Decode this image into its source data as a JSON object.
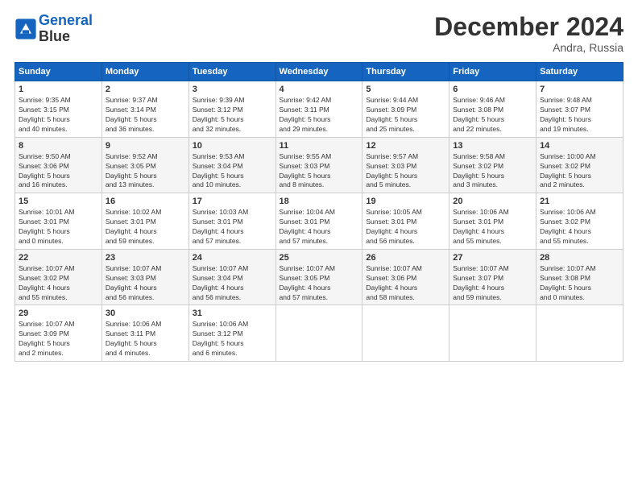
{
  "logo": {
    "line1": "General",
    "line2": "Blue"
  },
  "title": "December 2024",
  "location": "Andra, Russia",
  "header_days": [
    "Sunday",
    "Monday",
    "Tuesday",
    "Wednesday",
    "Thursday",
    "Friday",
    "Saturday"
  ],
  "weeks": [
    [
      {
        "day": "1",
        "sunrise": "9:35 AM",
        "sunset": "3:15 PM",
        "daylight": "5 hours and 40 minutes."
      },
      {
        "day": "2",
        "sunrise": "9:37 AM",
        "sunset": "3:14 PM",
        "daylight": "5 hours and 36 minutes."
      },
      {
        "day": "3",
        "sunrise": "9:39 AM",
        "sunset": "3:12 PM",
        "daylight": "5 hours and 32 minutes."
      },
      {
        "day": "4",
        "sunrise": "9:42 AM",
        "sunset": "3:11 PM",
        "daylight": "5 hours and 29 minutes."
      },
      {
        "day": "5",
        "sunrise": "9:44 AM",
        "sunset": "3:09 PM",
        "daylight": "5 hours and 25 minutes."
      },
      {
        "day": "6",
        "sunrise": "9:46 AM",
        "sunset": "3:08 PM",
        "daylight": "5 hours and 22 minutes."
      },
      {
        "day": "7",
        "sunrise": "9:48 AM",
        "sunset": "3:07 PM",
        "daylight": "5 hours and 19 minutes."
      }
    ],
    [
      {
        "day": "8",
        "sunrise": "9:50 AM",
        "sunset": "3:06 PM",
        "daylight": "5 hours and 16 minutes."
      },
      {
        "day": "9",
        "sunrise": "9:52 AM",
        "sunset": "3:05 PM",
        "daylight": "5 hours and 13 minutes."
      },
      {
        "day": "10",
        "sunrise": "9:53 AM",
        "sunset": "3:04 PM",
        "daylight": "5 hours and 10 minutes."
      },
      {
        "day": "11",
        "sunrise": "9:55 AM",
        "sunset": "3:03 PM",
        "daylight": "5 hours and 8 minutes."
      },
      {
        "day": "12",
        "sunrise": "9:57 AM",
        "sunset": "3:03 PM",
        "daylight": "5 hours and 5 minutes."
      },
      {
        "day": "13",
        "sunrise": "9:58 AM",
        "sunset": "3:02 PM",
        "daylight": "5 hours and 3 minutes."
      },
      {
        "day": "14",
        "sunrise": "10:00 AM",
        "sunset": "3:02 PM",
        "daylight": "5 hours and 2 minutes."
      }
    ],
    [
      {
        "day": "15",
        "sunrise": "10:01 AM",
        "sunset": "3:01 PM",
        "daylight": "5 hours and 0 minutes."
      },
      {
        "day": "16",
        "sunrise": "10:02 AM",
        "sunset": "3:01 PM",
        "daylight": "4 hours and 59 minutes."
      },
      {
        "day": "17",
        "sunrise": "10:03 AM",
        "sunset": "3:01 PM",
        "daylight": "4 hours and 57 minutes."
      },
      {
        "day": "18",
        "sunrise": "10:04 AM",
        "sunset": "3:01 PM",
        "daylight": "4 hours and 57 minutes."
      },
      {
        "day": "19",
        "sunrise": "10:05 AM",
        "sunset": "3:01 PM",
        "daylight": "4 hours and 56 minutes."
      },
      {
        "day": "20",
        "sunrise": "10:06 AM",
        "sunset": "3:01 PM",
        "daylight": "4 hours and 55 minutes."
      },
      {
        "day": "21",
        "sunrise": "10:06 AM",
        "sunset": "3:02 PM",
        "daylight": "4 hours and 55 minutes."
      }
    ],
    [
      {
        "day": "22",
        "sunrise": "10:07 AM",
        "sunset": "3:02 PM",
        "daylight": "4 hours and 55 minutes."
      },
      {
        "day": "23",
        "sunrise": "10:07 AM",
        "sunset": "3:03 PM",
        "daylight": "4 hours and 56 minutes."
      },
      {
        "day": "24",
        "sunrise": "10:07 AM",
        "sunset": "3:04 PM",
        "daylight": "4 hours and 56 minutes."
      },
      {
        "day": "25",
        "sunrise": "10:07 AM",
        "sunset": "3:05 PM",
        "daylight": "4 hours and 57 minutes."
      },
      {
        "day": "26",
        "sunrise": "10:07 AM",
        "sunset": "3:06 PM",
        "daylight": "4 hours and 58 minutes."
      },
      {
        "day": "27",
        "sunrise": "10:07 AM",
        "sunset": "3:07 PM",
        "daylight": "4 hours and 59 minutes."
      },
      {
        "day": "28",
        "sunrise": "10:07 AM",
        "sunset": "3:08 PM",
        "daylight": "5 hours and 0 minutes."
      }
    ],
    [
      {
        "day": "29",
        "sunrise": "10:07 AM",
        "sunset": "3:09 PM",
        "daylight": "5 hours and 2 minutes."
      },
      {
        "day": "30",
        "sunrise": "10:06 AM",
        "sunset": "3:11 PM",
        "daylight": "5 hours and 4 minutes."
      },
      {
        "day": "31",
        "sunrise": "10:06 AM",
        "sunset": "3:12 PM",
        "daylight": "5 hours and 6 minutes."
      },
      null,
      null,
      null,
      null
    ]
  ],
  "labels": {
    "sunrise": "Sunrise: ",
    "sunset": "Sunset: ",
    "daylight": "Daylight: "
  }
}
